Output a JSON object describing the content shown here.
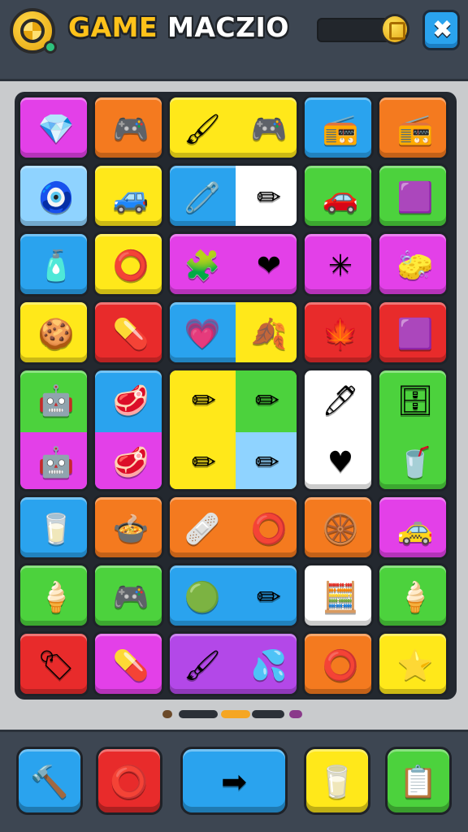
{
  "header": {
    "title_part1": "GAME",
    "title_part2": "MACZIO",
    "close_icon": "✖",
    "logo_icon": "wheel-logo-icon",
    "coin_icon": "coin-icon"
  },
  "board": {
    "tiles": [
      {
        "name": "tile-gem",
        "icon": "💎",
        "bg": "#e340e8"
      },
      {
        "name": "tile-gamepad",
        "icon": "🎮",
        "bg": "#f47a1f"
      },
      {
        "name": "tile-brush-gamepad",
        "icon": "🖌",
        "icon2": "🎮",
        "bg": "#ffe81a"
      },
      {
        "name": "tile-radio-pink",
        "icon": "📻",
        "bg": "#2aa3ee"
      },
      {
        "name": "tile-boombox",
        "icon": "📻",
        "bg": "#f47a1f"
      },
      {
        "name": "tile-red-blob",
        "icon": "🧿",
        "bg": "#8fd3ff"
      },
      {
        "name": "tile-blue-car",
        "icon": "🚙",
        "bg": "#ffe81a"
      },
      {
        "name": "tile-pacifier-pencil",
        "icon": "🧷",
        "icon2": "✏",
        "bg": "#2aa3ee",
        "bg2": "#ffffff"
      },
      {
        "name": "tile-green-car",
        "icon": "🚗",
        "bg": "#4cd23d"
      },
      {
        "name": "tile-purple-box",
        "icon": "🟪",
        "bg": "#4cd23d"
      },
      {
        "name": "tile-pink-bottle",
        "icon": "🧴",
        "bg": "#2aa3ee"
      },
      {
        "name": "tile-green-ring",
        "icon": "⭕",
        "bg": "#ffe81a"
      },
      {
        "name": "tile-fidget-heart",
        "icon": "🧩",
        "icon2": "❤",
        "bg": "#e340e8"
      },
      {
        "name": "tile-splat",
        "icon": "✳",
        "bg": "#e340e8"
      },
      {
        "name": "tile-yellow-cloth",
        "icon": "🧽",
        "bg": "#e340e8"
      },
      {
        "name": "tile-cracker",
        "icon": "🍪",
        "bg": "#ffe81a"
      },
      {
        "name": "tile-pill",
        "icon": "💊",
        "bg": "#e82b2b"
      },
      {
        "name": "tile-heart-leaf",
        "icon": "💗",
        "icon2": "🍂",
        "bg": "#2aa3ee",
        "bg2": "#ffe81a"
      },
      {
        "name": "tile-orange-leaf",
        "icon": "🍁",
        "bg": "#e82b2b"
      },
      {
        "name": "tile-purple-chunk",
        "icon": "🟪",
        "bg": "#e82b2b"
      },
      {
        "name": "tile-robot",
        "icon": "🤖",
        "bg": "#4cd23d"
      },
      {
        "name": "tile-steak",
        "icon": "🥩",
        "bg": "#2aa3ee"
      },
      {
        "name": "tile-pencils",
        "icon": "✏",
        "bg": "#ffe81a"
      },
      {
        "name": "tile-blue-pen-heart",
        "icon": "🖊",
        "icon2": "♥",
        "bg": "#ffffff"
      },
      {
        "name": "tile-fridge-cup",
        "icon": "🗄",
        "icon2": "🥤",
        "bg": "#4cd23d"
      },
      {
        "name": "tile-cup",
        "icon": "🥛",
        "bg": "#2aa3ee"
      },
      {
        "name": "tile-bowl",
        "icon": "🍲",
        "bg": "#f47a1f"
      },
      {
        "name": "tile-bandage-donut",
        "icon": "🩹",
        "icon2": "⭕",
        "bg": "#f47a1f"
      },
      {
        "name": "tile-wheel",
        "icon": "🛞",
        "bg": "#f47a1f"
      },
      {
        "name": "tile-orange-car",
        "icon": "🚕",
        "bg": "#e340e8"
      },
      {
        "name": "tile-ice-cream",
        "icon": "🍦",
        "bg": "#4cd23d"
      },
      {
        "name": "tile-gamepad-blue",
        "icon": "🎮",
        "bg": "#4cd23d"
      },
      {
        "name": "tile-blob-pencil",
        "icon": "🟢",
        "icon2": "✏",
        "bg": "#2aa3ee"
      },
      {
        "name": "tile-calculator",
        "icon": "🧮",
        "bg": "#ffffff"
      },
      {
        "name": "tile-ice-cream-2",
        "icon": "🍦",
        "bg": "#4cd23d"
      },
      {
        "name": "tile-yellow-card",
        "icon": "🏷",
        "bg": "#e82b2b"
      },
      {
        "name": "tile-yellow-pill",
        "icon": "💊",
        "bg": "#e340e8"
      },
      {
        "name": "tile-brush-splash",
        "icon": "🖌",
        "icon2": "💦",
        "bg": "#b348e8"
      },
      {
        "name": "tile-blue-ring",
        "icon": "⭕",
        "bg": "#f47a1f"
      },
      {
        "name": "tile-pink-star",
        "icon": "⭐",
        "bg": "#ffe81a"
      }
    ]
  },
  "pager": {
    "pages": 4,
    "active": 2
  },
  "toolbar": {
    "buttons": [
      {
        "name": "hammer-button",
        "icon": "🔨",
        "bg": "#2aa3ee"
      },
      {
        "name": "ring-button",
        "icon": "⭕",
        "bg": "#e82b2b"
      },
      {
        "name": "arrow-button",
        "icon": "➡",
        "bg": "#2aa3ee"
      },
      {
        "name": "cup-button",
        "icon": "🥛",
        "bg": "#ffe81a"
      },
      {
        "name": "menu-button",
        "icon": "📋",
        "bg": "#4cd23d"
      }
    ]
  }
}
